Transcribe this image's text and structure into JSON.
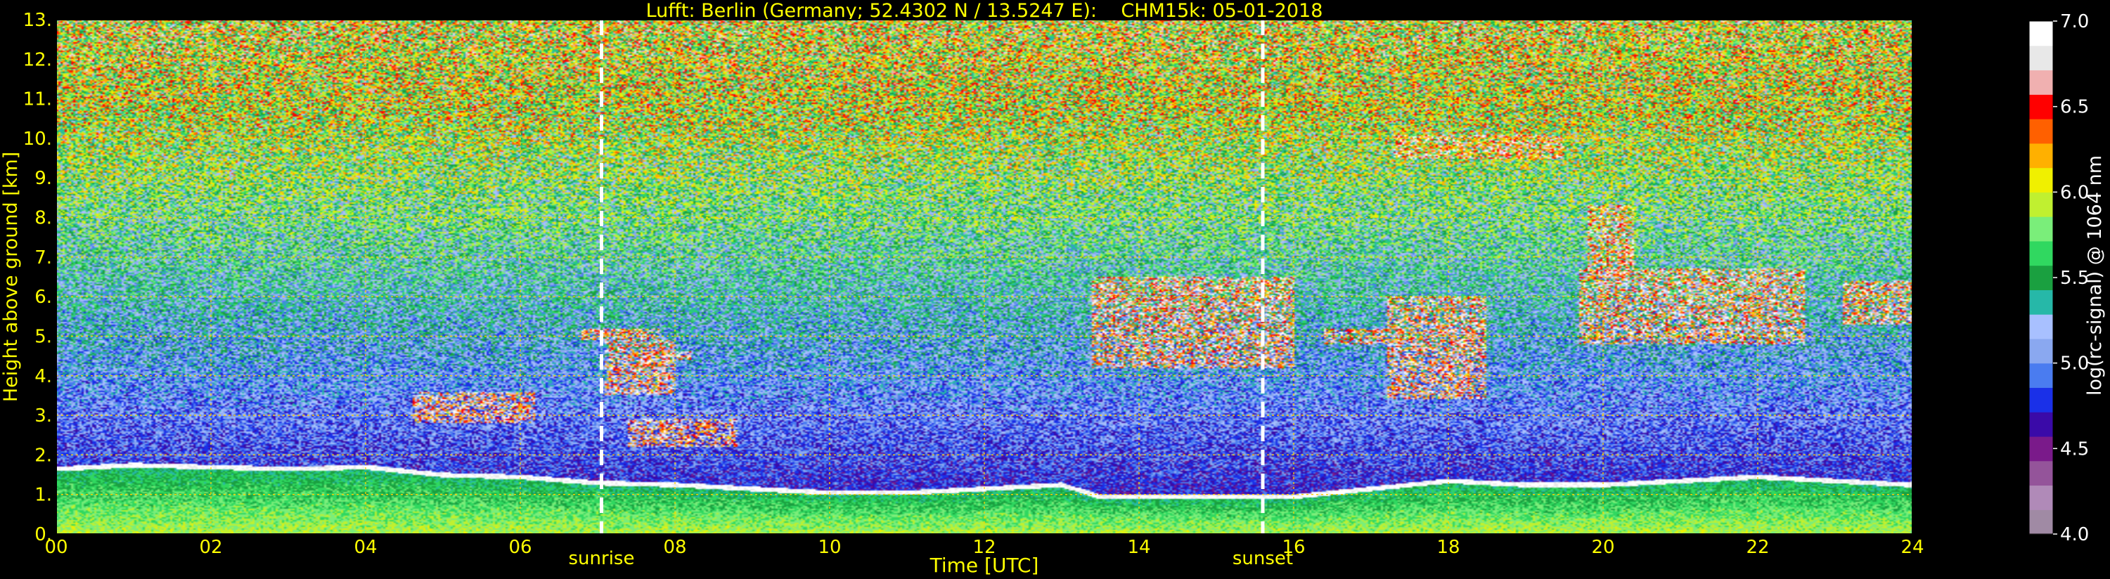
{
  "chart_data": {
    "type": "heatmap",
    "title": "Lufft: Berlin (Germany; 52.4302 N / 13.5247 E):    CHM15k: 05-01-2018",
    "xlabel": "Time [UTC]",
    "ylabel": "Height above ground [km]",
    "xlim": [
      0,
      24
    ],
    "ylim": [
      0,
      13
    ],
    "x_ticks": [
      "00",
      "02",
      "04",
      "06",
      "08",
      "10",
      "12",
      "14",
      "16",
      "18",
      "20",
      "22",
      "24"
    ],
    "y_ticks": [
      "0.",
      "1.",
      "2.",
      "3.",
      "4.",
      "5.",
      "6.",
      "7.",
      "8.",
      "9.",
      "10.",
      "11.",
      "12.",
      "13."
    ],
    "grid": true,
    "colorbar": {
      "label": "log(rc-signal) @ 1064 nm",
      "range": [
        4.0,
        7.0
      ],
      "ticks": [
        "4.0",
        "4.5",
        "5.0",
        "5.5",
        "6.0",
        "6.5",
        "7.0"
      ],
      "colors": [
        "#a08aa4",
        "#b08ab8",
        "#94549a",
        "#7a1a8a",
        "#3a0aa8",
        "#1a30e8",
        "#4a7cf0",
        "#8aa8f0",
        "#a8c0ff",
        "#26b8a8",
        "#1aa040",
        "#30d860",
        "#7aee7a",
        "#c0f030",
        "#f0f000",
        "#ffb000",
        "#ff6000",
        "#ff0000",
        "#f0b0b0",
        "#e8e8e8",
        "#ffffff"
      ]
    },
    "annotations": [
      {
        "text": "sunrise",
        "x": 7.05
      },
      {
        "text": "sunset",
        "x": 15.6
      }
    ],
    "features": {
      "boundary_layer_top_km": [
        [
          0.0,
          1.7
        ],
        [
          1.0,
          1.8
        ],
        [
          2.0,
          1.75
        ],
        [
          3.0,
          1.7
        ],
        [
          4.0,
          1.75
        ],
        [
          5.0,
          1.55
        ],
        [
          6.0,
          1.5
        ],
        [
          7.0,
          1.35
        ],
        [
          8.0,
          1.3
        ],
        [
          9.0,
          1.2
        ],
        [
          10.0,
          1.1
        ],
        [
          11.0,
          1.1
        ],
        [
          12.0,
          1.2
        ],
        [
          13.0,
          1.3
        ],
        [
          13.5,
          1.0
        ],
        [
          14.5,
          1.0
        ],
        [
          16.0,
          1.0
        ],
        [
          17.0,
          1.2
        ],
        [
          18.0,
          1.4
        ],
        [
          19.0,
          1.3
        ],
        [
          20.0,
          1.3
        ],
        [
          21.0,
          1.4
        ],
        [
          22.0,
          1.5
        ],
        [
          23.0,
          1.4
        ],
        [
          24.0,
          1.3
        ]
      ],
      "cloud_layers": [
        {
          "t0": 4.6,
          "t1": 6.2,
          "h0": 2.8,
          "h1": 3.6
        },
        {
          "t0": 6.8,
          "t1": 7.8,
          "h0": 4.9,
          "h1": 5.2
        },
        {
          "t0": 7.1,
          "t1": 8.0,
          "h0": 3.5,
          "h1": 4.9
        },
        {
          "t0": 7.6,
          "t1": 8.2,
          "h0": 4.4,
          "h1": 4.6
        },
        {
          "t0": 7.4,
          "t1": 8.8,
          "h0": 2.2,
          "h1": 2.9
        },
        {
          "t0": 13.4,
          "t1": 16.0,
          "h0": 4.2,
          "h1": 6.5
        },
        {
          "t0": 16.4,
          "t1": 17.2,
          "h0": 4.8,
          "h1": 5.2
        },
        {
          "t0": 17.2,
          "t1": 18.5,
          "h0": 3.4,
          "h1": 6.0
        },
        {
          "t0": 17.3,
          "t1": 19.5,
          "h0": 9.5,
          "h1": 10.1
        },
        {
          "t0": 19.8,
          "t1": 20.4,
          "h0": 6.5,
          "h1": 8.3
        },
        {
          "t0": 19.7,
          "t1": 22.6,
          "h0": 4.8,
          "h1": 6.7
        },
        {
          "t0": 23.1,
          "t1": 24.0,
          "h0": 5.3,
          "h1": 6.4
        }
      ]
    }
  }
}
